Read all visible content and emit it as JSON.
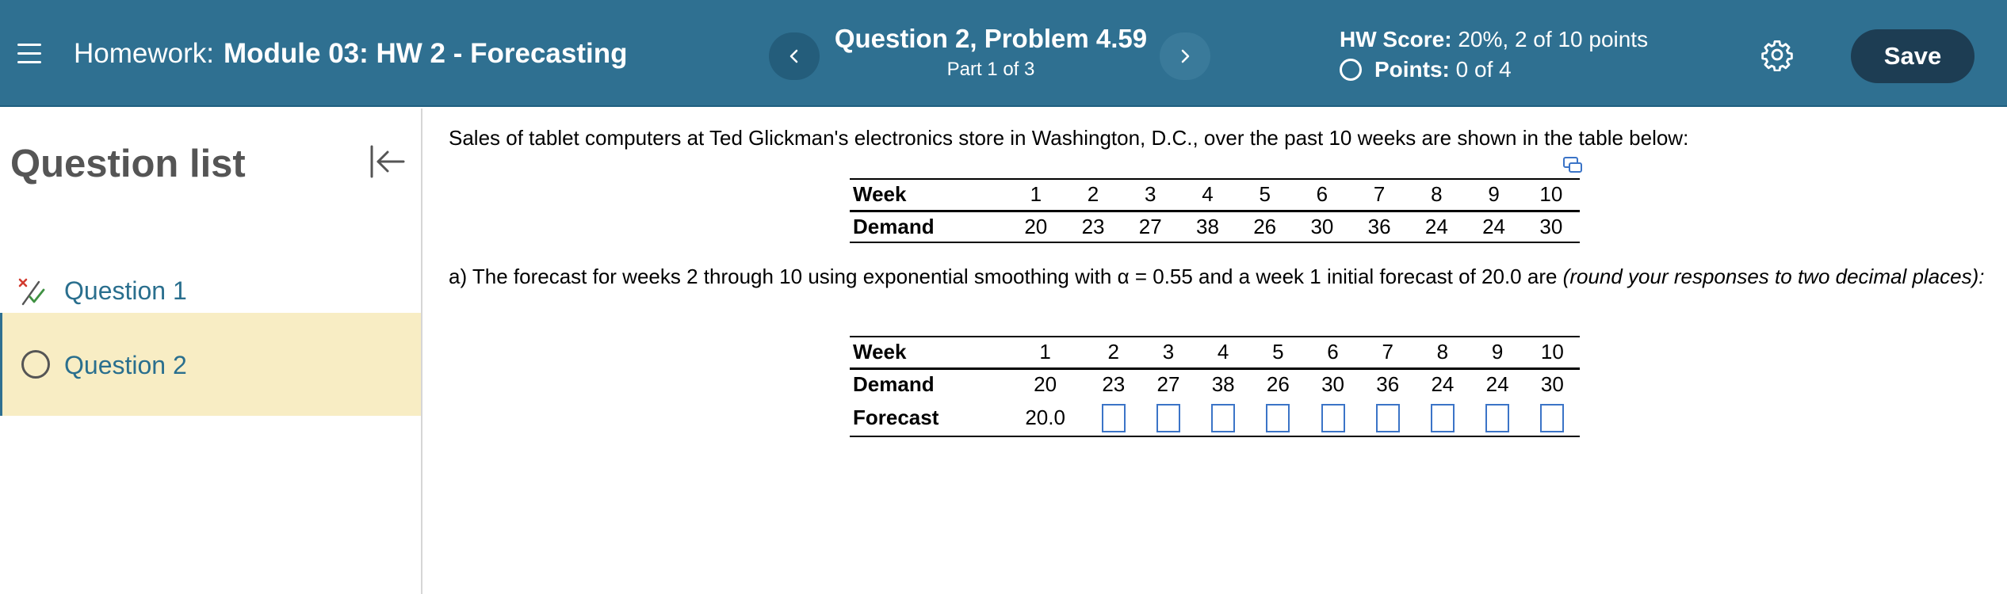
{
  "header": {
    "homework_prefix": "Homework:",
    "homework_name": "Module 03: HW 2 - Forecasting",
    "question_title": "Question 2, Problem 4.59",
    "part_label": "Part 1 of 3",
    "hw_score_label": "HW Score:",
    "hw_score_value": "20%, 2 of 10 points",
    "points_label": "Points:",
    "points_value": "0 of 4",
    "save_label": "Save",
    "prev_icon": "chevron-left-icon",
    "next_icon": "chevron-right-icon",
    "menu_icon": "hamburger-menu-icon",
    "settings_icon": "gear-icon",
    "colors": {
      "bar": "#2f7091",
      "save_button": "#1d3d53"
    }
  },
  "sidebar": {
    "title": "Question list",
    "collapse_icon": "collapse-left-icon",
    "items": [
      {
        "label": "Question 1",
        "status_icon": "partial-credit-icon",
        "selected": false
      },
      {
        "label": "Question 2",
        "status_icon": "open-circle-icon",
        "selected": true
      }
    ],
    "colors": {
      "selected_bg": "#f8edc4",
      "link": "#2a6f8e"
    }
  },
  "main": {
    "intro": "Sales of tablet computers at Ted Glickman's electronics store in Washington, D.C., over the past 10 weeks are shown in the table below:",
    "table1": {
      "row_headers": [
        "Week",
        "Demand"
      ],
      "weeks": [
        "1",
        "2",
        "3",
        "4",
        "5",
        "6",
        "7",
        "8",
        "9",
        "10"
      ],
      "demand": [
        "20",
        "23",
        "27",
        "38",
        "26",
        "30",
        "36",
        "24",
        "24",
        "30"
      ]
    },
    "part_a_text": "a) The forecast for weeks 2 through 10 using exponential smoothing with α = 0.55 and a week 1 initial forecast of 20.0 are ",
    "part_a_instruction": "(round your responses to two decimal places):",
    "table2": {
      "row_headers": [
        "Week",
        "Demand",
        "Forecast"
      ],
      "weeks": [
        "1",
        "2",
        "3",
        "4",
        "5",
        "6",
        "7",
        "8",
        "9",
        "10"
      ],
      "demand": [
        "20",
        "23",
        "27",
        "38",
        "26",
        "30",
        "36",
        "24",
        "24",
        "30"
      ],
      "forecast_week1": "20.0",
      "forecast_inputs": [
        "",
        "",
        "",
        "",
        "",
        "",
        "",
        "",
        ""
      ]
    }
  }
}
